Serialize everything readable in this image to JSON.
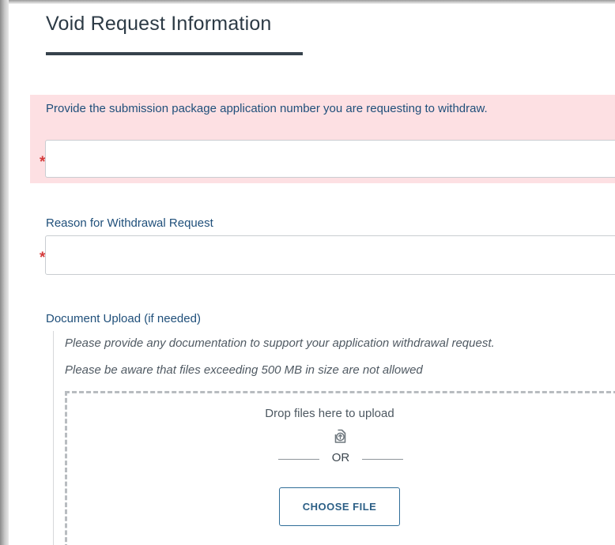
{
  "page": {
    "title": "Void Request Information"
  },
  "application_number": {
    "label": "Provide the submission package application number you are requesting to withdraw.",
    "required_marker": "*",
    "value": "",
    "has_error": true
  },
  "reason": {
    "label": "Reason for Withdrawal Request",
    "required_marker": "*",
    "value": ""
  },
  "document_upload": {
    "label": "Document Upload (if needed)",
    "help_text": "Please provide any documentation to support your application withdrawal request.",
    "size_notice": "Please be aware that files exceeding 500 MB in size are not allowed",
    "drop_text": "Drop files here to upload",
    "or_text": "OR",
    "button_label": "CHOOSE FILE",
    "icon": "upload-icon"
  },
  "colors": {
    "label_blue": "#1f4f7a",
    "error_background": "#fde0e3",
    "required_red": "#d43a3a",
    "button_border": "#2f6d98",
    "title_underline": "#36424c"
  }
}
